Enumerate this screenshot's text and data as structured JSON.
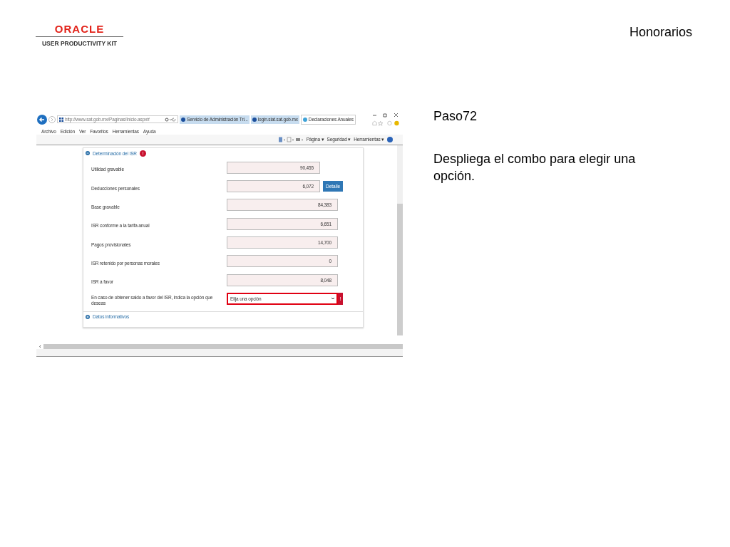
{
  "brand": {
    "logo": "ORACLE",
    "subtitle": "USER PRODUCTIVITY KIT"
  },
  "title": "Honorarios",
  "step": "Paso72",
  "instruction": "Despliega el combo para elegir una opción.",
  "browser": {
    "address": "http://www.sat.gob.mx/Paginas/Inicio.aspx#",
    "tabs": [
      {
        "label": "Servicio de Administración Tri...",
        "selected": false
      },
      {
        "label": "login.siat.sat.gob.mx",
        "selected": false
      },
      {
        "label": "Declaraciones Anuales",
        "selected": true
      }
    ],
    "menu": [
      "Archivo",
      "Edición",
      "Ver",
      "Favoritos",
      "Herramientas",
      "Ayuda"
    ],
    "toolbar": [
      "Página ▾",
      "Seguridad ▾",
      "Herramientas ▾"
    ],
    "scroll_arrow": "‹"
  },
  "sections": [
    {
      "title": "Determinación del ISR",
      "expanded": true,
      "badge": "!",
      "rows": [
        {
          "kind": "field",
          "label": "Utilidad gravable",
          "value": "90,455",
          "short": true
        },
        {
          "kind": "field",
          "label": "Deducciones personales",
          "value": "6,072",
          "short": true,
          "button": "Detalle"
        },
        {
          "kind": "field",
          "label": "Base gravable",
          "value": "84,383",
          "short": false
        },
        {
          "kind": "field",
          "label": "ISR conforme a la tarifa anual",
          "value": "6,651",
          "short": false
        },
        {
          "kind": "field",
          "label": "Pagos provisionales",
          "value": "14,700",
          "short": false
        },
        {
          "kind": "field",
          "label": "ISR retenido por personas morales",
          "value": "0",
          "short": false
        },
        {
          "kind": "field",
          "label": "ISR a favor",
          "value": "8,048",
          "short": false
        },
        {
          "kind": "select",
          "label": "En caso de obtener saldo a favor del ISR, indica la opción que deseas",
          "value": "Elija una opción",
          "error": "!"
        }
      ]
    },
    {
      "title": "Datos informativos",
      "expanded": false
    }
  ]
}
